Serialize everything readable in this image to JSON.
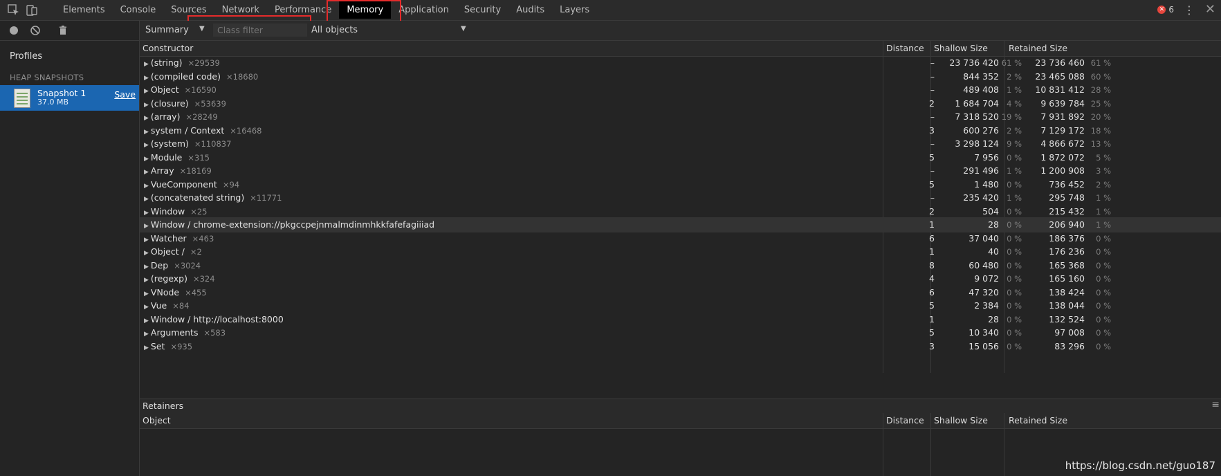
{
  "tabs": [
    "Elements",
    "Console",
    "Sources",
    "Network",
    "Performance",
    "Memory",
    "Application",
    "Security",
    "Audits",
    "Layers"
  ],
  "active_tab": "Memory",
  "error_count": "6",
  "sidebar": {
    "profiles_title": "Profiles",
    "heap_header": "HEAP SNAPSHOTS",
    "snapshot_name": "Snapshot 1",
    "snapshot_size": "37.0 MB",
    "save_label": "Save"
  },
  "filter": {
    "view_label": "Summary",
    "class_filter_placeholder": "Class filter",
    "objects_label": "All objects"
  },
  "columns": {
    "constructor": "Constructor",
    "distance": "Distance",
    "shallow": "Shallow Size",
    "retained": "Retained Size"
  },
  "rows": [
    {
      "name": "(string)",
      "count": "×29539",
      "distance": "–",
      "shallow": "23 736 420",
      "shallow_pct": "61 %",
      "retained": "23 736 460",
      "retained_pct": "61 %"
    },
    {
      "name": "(compiled code)",
      "count": "×18680",
      "distance": "–",
      "shallow": "844 352",
      "shallow_pct": "2 %",
      "retained": "23 465 088",
      "retained_pct": "60 %"
    },
    {
      "name": "Object",
      "count": "×16590",
      "distance": "–",
      "shallow": "489 408",
      "shallow_pct": "1 %",
      "retained": "10 831 412",
      "retained_pct": "28 %"
    },
    {
      "name": "(closure)",
      "count": "×53639",
      "distance": "2",
      "shallow": "1 684 704",
      "shallow_pct": "4 %",
      "retained": "9 639 784",
      "retained_pct": "25 %"
    },
    {
      "name": "(array)",
      "count": "×28249",
      "distance": "–",
      "shallow": "7 318 520",
      "shallow_pct": "19 %",
      "retained": "7 931 892",
      "retained_pct": "20 %"
    },
    {
      "name": "system / Context",
      "count": "×16468",
      "distance": "3",
      "shallow": "600 276",
      "shallow_pct": "2 %",
      "retained": "7 129 172",
      "retained_pct": "18 %"
    },
    {
      "name": "(system)",
      "count": "×110837",
      "distance": "–",
      "shallow": "3 298 124",
      "shallow_pct": "9 %",
      "retained": "4 866 672",
      "retained_pct": "13 %"
    },
    {
      "name": "Module",
      "count": "×315",
      "distance": "5",
      "shallow": "7 956",
      "shallow_pct": "0 %",
      "retained": "1 872 072",
      "retained_pct": "5 %"
    },
    {
      "name": "Array",
      "count": "×18169",
      "distance": "–",
      "shallow": "291 496",
      "shallow_pct": "1 %",
      "retained": "1 200 908",
      "retained_pct": "3 %"
    },
    {
      "name": "VueComponent",
      "count": "×94",
      "distance": "5",
      "shallow": "1 480",
      "shallow_pct": "0 %",
      "retained": "736 452",
      "retained_pct": "2 %"
    },
    {
      "name": "(concatenated string)",
      "count": "×11771",
      "distance": "–",
      "shallow": "235 420",
      "shallow_pct": "1 %",
      "retained": "295 748",
      "retained_pct": "1 %"
    },
    {
      "name": "Window",
      "count": "×25",
      "distance": "2",
      "shallow": "504",
      "shallow_pct": "0 %",
      "retained": "215 432",
      "retained_pct": "1 %"
    },
    {
      "name": "Window / chrome-extension://pkgccpejnmalmdinmhkkfafefagiiiad",
      "count": "",
      "distance": "1",
      "shallow": "28",
      "shallow_pct": "0 %",
      "retained": "206 940",
      "retained_pct": "1 %",
      "selected": true
    },
    {
      "name": "Watcher",
      "count": "×463",
      "distance": "6",
      "shallow": "37 040",
      "shallow_pct": "0 %",
      "retained": "186 376",
      "retained_pct": "0 %"
    },
    {
      "name": "Object /",
      "count": "×2",
      "distance": "1",
      "shallow": "40",
      "shallow_pct": "0 %",
      "retained": "176 236",
      "retained_pct": "0 %"
    },
    {
      "name": "Dep",
      "count": "×3024",
      "distance": "8",
      "shallow": "60 480",
      "shallow_pct": "0 %",
      "retained": "165 368",
      "retained_pct": "0 %"
    },
    {
      "name": "(regexp)",
      "count": "×324",
      "distance": "4",
      "shallow": "9 072",
      "shallow_pct": "0 %",
      "retained": "165 160",
      "retained_pct": "0 %"
    },
    {
      "name": "VNode",
      "count": "×455",
      "distance": "6",
      "shallow": "47 320",
      "shallow_pct": "0 %",
      "retained": "138 424",
      "retained_pct": "0 %"
    },
    {
      "name": "Vue",
      "count": "×84",
      "distance": "5",
      "shallow": "2 384",
      "shallow_pct": "0 %",
      "retained": "138 044",
      "retained_pct": "0 %"
    },
    {
      "name": "Window / http://localhost:8000",
      "count": "",
      "distance": "1",
      "shallow": "28",
      "shallow_pct": "0 %",
      "retained": "132 524",
      "retained_pct": "0 %"
    },
    {
      "name": "Arguments",
      "count": "×583",
      "distance": "5",
      "shallow": "10 340",
      "shallow_pct": "0 %",
      "retained": "97 008",
      "retained_pct": "0 %"
    },
    {
      "name": "Set",
      "count": "×935",
      "distance": "3",
      "shallow": "15 056",
      "shallow_pct": "0 %",
      "retained": "83 296",
      "retained_pct": "0 %"
    }
  ],
  "retainers": {
    "title": "Retainers",
    "object": "Object",
    "distance": "Distance",
    "shallow": "Shallow Size",
    "retained": "Retained Size"
  },
  "watermark": "https://blog.csdn.net/guo187"
}
